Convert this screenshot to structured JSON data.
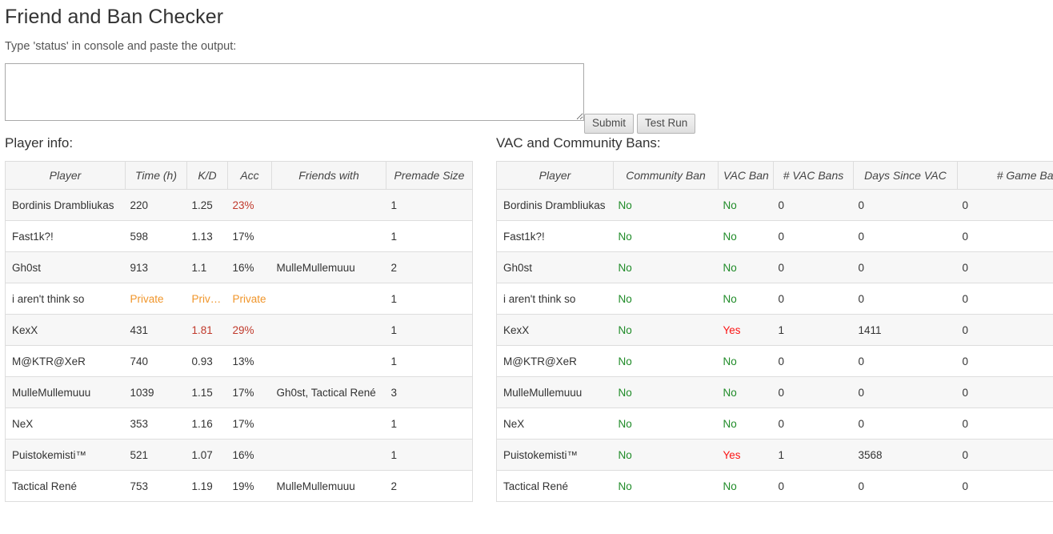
{
  "header": {
    "title": "Friend and Ban Checker",
    "instruction": "Type 'status' in console and paste the output:"
  },
  "form": {
    "textarea_value": "",
    "textarea_placeholder": "",
    "submit_label": "Submit",
    "test_run_label": "Test Run"
  },
  "colors": {
    "private": "#f0952a",
    "danger_red": "#c0392b",
    "ban_red": "#fb1414",
    "ok_green": "#1f8b28",
    "border": "#dddddd",
    "header_bg": "#f6f6f6",
    "stripe_bg": "#f7f7f7"
  },
  "player_info": {
    "section_title": "Player info:",
    "columns": [
      "Player",
      "Time (h)",
      "K/D",
      "Acc",
      "Friends with",
      "Premade Size"
    ],
    "rows": [
      {
        "player": "Bordinis Drambliukas",
        "time": "220",
        "time_state": "normal",
        "kd": "1.25",
        "kd_state": "normal",
        "acc": "23%",
        "acc_state": "red",
        "friends": "",
        "premade": "1"
      },
      {
        "player": "Fast1k?!",
        "time": "598",
        "time_state": "normal",
        "kd": "1.13",
        "kd_state": "normal",
        "acc": "17%",
        "acc_state": "normal",
        "friends": "",
        "premade": "1"
      },
      {
        "player": "Gh0st",
        "time": "913",
        "time_state": "normal",
        "kd": "1.1",
        "kd_state": "normal",
        "acc": "16%",
        "acc_state": "normal",
        "friends": "MulleMullemuuu",
        "premade": "2"
      },
      {
        "player": "i aren't think so",
        "time": "Private",
        "time_state": "private",
        "kd": "Private",
        "kd_state": "private",
        "acc": "Private",
        "acc_state": "private",
        "friends": "",
        "premade": "1"
      },
      {
        "player": "KexX",
        "time": "431",
        "time_state": "normal",
        "kd": "1.81",
        "kd_state": "red",
        "acc": "29%",
        "acc_state": "red",
        "friends": "",
        "premade": "1"
      },
      {
        "player": "M@KTR@XeR",
        "time": "740",
        "time_state": "normal",
        "kd": "0.93",
        "kd_state": "normal",
        "acc": "13%",
        "acc_state": "normal",
        "friends": "",
        "premade": "1"
      },
      {
        "player": "MulleMullemuuu",
        "time": "1039",
        "time_state": "normal",
        "kd": "1.15",
        "kd_state": "normal",
        "acc": "17%",
        "acc_state": "normal",
        "friends": "Gh0st, Tactical René",
        "premade": "3"
      },
      {
        "player": "NeX",
        "time": "353",
        "time_state": "normal",
        "kd": "1.16",
        "kd_state": "normal",
        "acc": "17%",
        "acc_state": "normal",
        "friends": "",
        "premade": "1"
      },
      {
        "player": "Puistokemisti™",
        "time": "521",
        "time_state": "normal",
        "kd": "1.07",
        "kd_state": "normal",
        "acc": "16%",
        "acc_state": "normal",
        "friends": "",
        "premade": "1"
      },
      {
        "player": "Tactical René",
        "time": "753",
        "time_state": "normal",
        "kd": "1.19",
        "kd_state": "normal",
        "acc": "19%",
        "acc_state": "normal",
        "friends": "MulleMullemuuu",
        "premade": "2"
      }
    ]
  },
  "bans": {
    "section_title": "VAC and Community Bans:",
    "columns": [
      "Player",
      "Community Ban",
      "VAC Ban",
      "# VAC Bans",
      "Days Since VAC",
      "# Game Bans"
    ],
    "rows": [
      {
        "player": "Bordinis Drambliukas",
        "community_ban": "No",
        "vac_ban": "No",
        "num_vac_bans": "0",
        "days_since_vac": "0",
        "num_game_bans": "0"
      },
      {
        "player": "Fast1k?!",
        "community_ban": "No",
        "vac_ban": "No",
        "num_vac_bans": "0",
        "days_since_vac": "0",
        "num_game_bans": "0"
      },
      {
        "player": "Gh0st",
        "community_ban": "No",
        "vac_ban": "No",
        "num_vac_bans": "0",
        "days_since_vac": "0",
        "num_game_bans": "0"
      },
      {
        "player": "i aren't think so",
        "community_ban": "No",
        "vac_ban": "No",
        "num_vac_bans": "0",
        "days_since_vac": "0",
        "num_game_bans": "0"
      },
      {
        "player": "KexX",
        "community_ban": "No",
        "vac_ban": "Yes",
        "num_vac_bans": "1",
        "days_since_vac": "1411",
        "num_game_bans": "0"
      },
      {
        "player": "M@KTR@XeR",
        "community_ban": "No",
        "vac_ban": "No",
        "num_vac_bans": "0",
        "days_since_vac": "0",
        "num_game_bans": "0"
      },
      {
        "player": "MulleMullemuuu",
        "community_ban": "No",
        "vac_ban": "No",
        "num_vac_bans": "0",
        "days_since_vac": "0",
        "num_game_bans": "0"
      },
      {
        "player": "NeX",
        "community_ban": "No",
        "vac_ban": "No",
        "num_vac_bans": "0",
        "days_since_vac": "0",
        "num_game_bans": "0"
      },
      {
        "player": "Puistokemisti™",
        "community_ban": "No",
        "vac_ban": "Yes",
        "num_vac_bans": "1",
        "days_since_vac": "3568",
        "num_game_bans": "0"
      },
      {
        "player": "Tactical René",
        "community_ban": "No",
        "vac_ban": "No",
        "num_vac_bans": "0",
        "days_since_vac": "0",
        "num_game_bans": "0"
      }
    ]
  }
}
